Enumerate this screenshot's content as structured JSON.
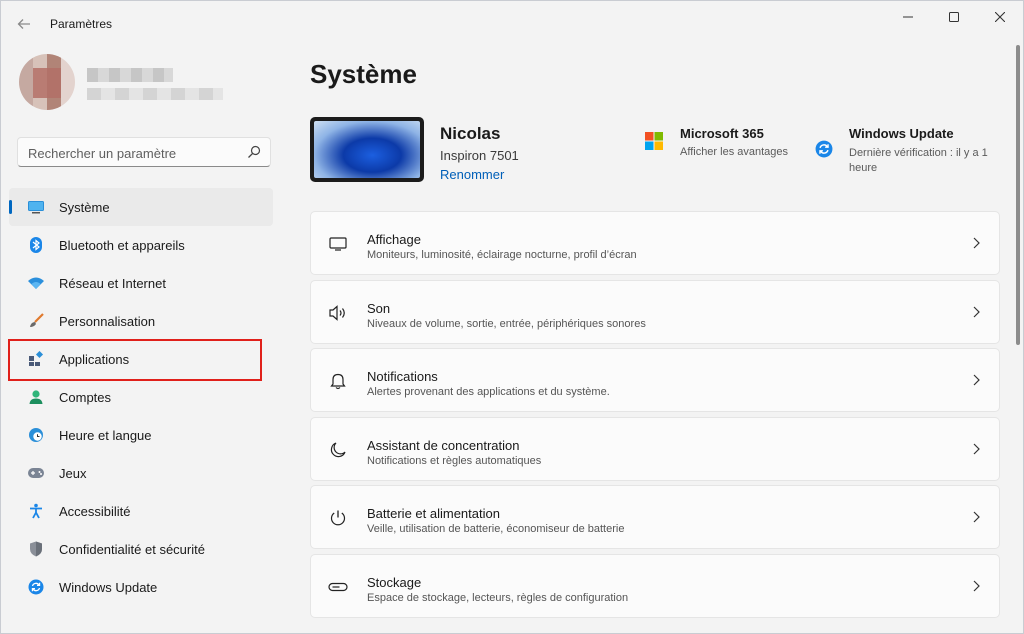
{
  "window": {
    "title": "Paramètres",
    "back_icon": "back-arrow-icon",
    "controls": [
      "minimize-icon",
      "maximize-icon",
      "close-icon"
    ]
  },
  "sidebar": {
    "search": {
      "placeholder": "Rechercher un paramètre",
      "icon": "search-icon"
    },
    "items": [
      {
        "label": "Système",
        "icon": "display-icon",
        "active": true
      },
      {
        "label": "Bluetooth et appareils",
        "icon": "bluetooth-icon"
      },
      {
        "label": "Réseau et Internet",
        "icon": "wifi-icon"
      },
      {
        "label": "Personnalisation",
        "icon": "paintbrush-icon"
      },
      {
        "label": "Applications",
        "icon": "apps-icon"
      },
      {
        "label": "Comptes",
        "icon": "person-icon"
      },
      {
        "label": "Heure et langue",
        "icon": "globe-clock-icon"
      },
      {
        "label": "Jeux",
        "icon": "gamepad-icon"
      },
      {
        "label": "Accessibilité",
        "icon": "accessibility-icon"
      },
      {
        "label": "Confidentialité et sécurité",
        "icon": "shield-icon"
      },
      {
        "label": "Windows Update",
        "icon": "sync-icon"
      }
    ],
    "accent_color": "#0067c0",
    "highlight_color": "#e0201a"
  },
  "main": {
    "title": "Système",
    "device": {
      "name": "Nicolas",
      "model": "Inspiron 7501",
      "rename_label": "Renommer"
    },
    "ms365": {
      "title": "Microsoft 365",
      "subtitle": "Afficher les avantages"
    },
    "windows_update": {
      "title": "Windows Update",
      "subtitle": "Dernière vérification : il y a 1 heure"
    },
    "cards": [
      {
        "title": "Affichage",
        "subtitle": "Moniteurs, luminosité, éclairage nocturne, profil d’écran",
        "icon": "monitor-icon"
      },
      {
        "title": "Son",
        "subtitle": "Niveaux de volume, sortie, entrée, périphériques sonores",
        "icon": "speaker-icon"
      },
      {
        "title": "Notifications",
        "subtitle": "Alertes provenant des applications et du système.",
        "icon": "bell-icon"
      },
      {
        "title": "Assistant de concentration",
        "subtitle": "Notifications et règles automatiques",
        "icon": "moon-icon"
      },
      {
        "title": "Batterie et alimentation",
        "subtitle": "Veille, utilisation de batterie, économiseur de batterie",
        "icon": "power-icon"
      },
      {
        "title": "Stockage",
        "subtitle": "Espace de stockage, lecteurs, règles de configuration",
        "icon": "storage-icon"
      }
    ]
  }
}
